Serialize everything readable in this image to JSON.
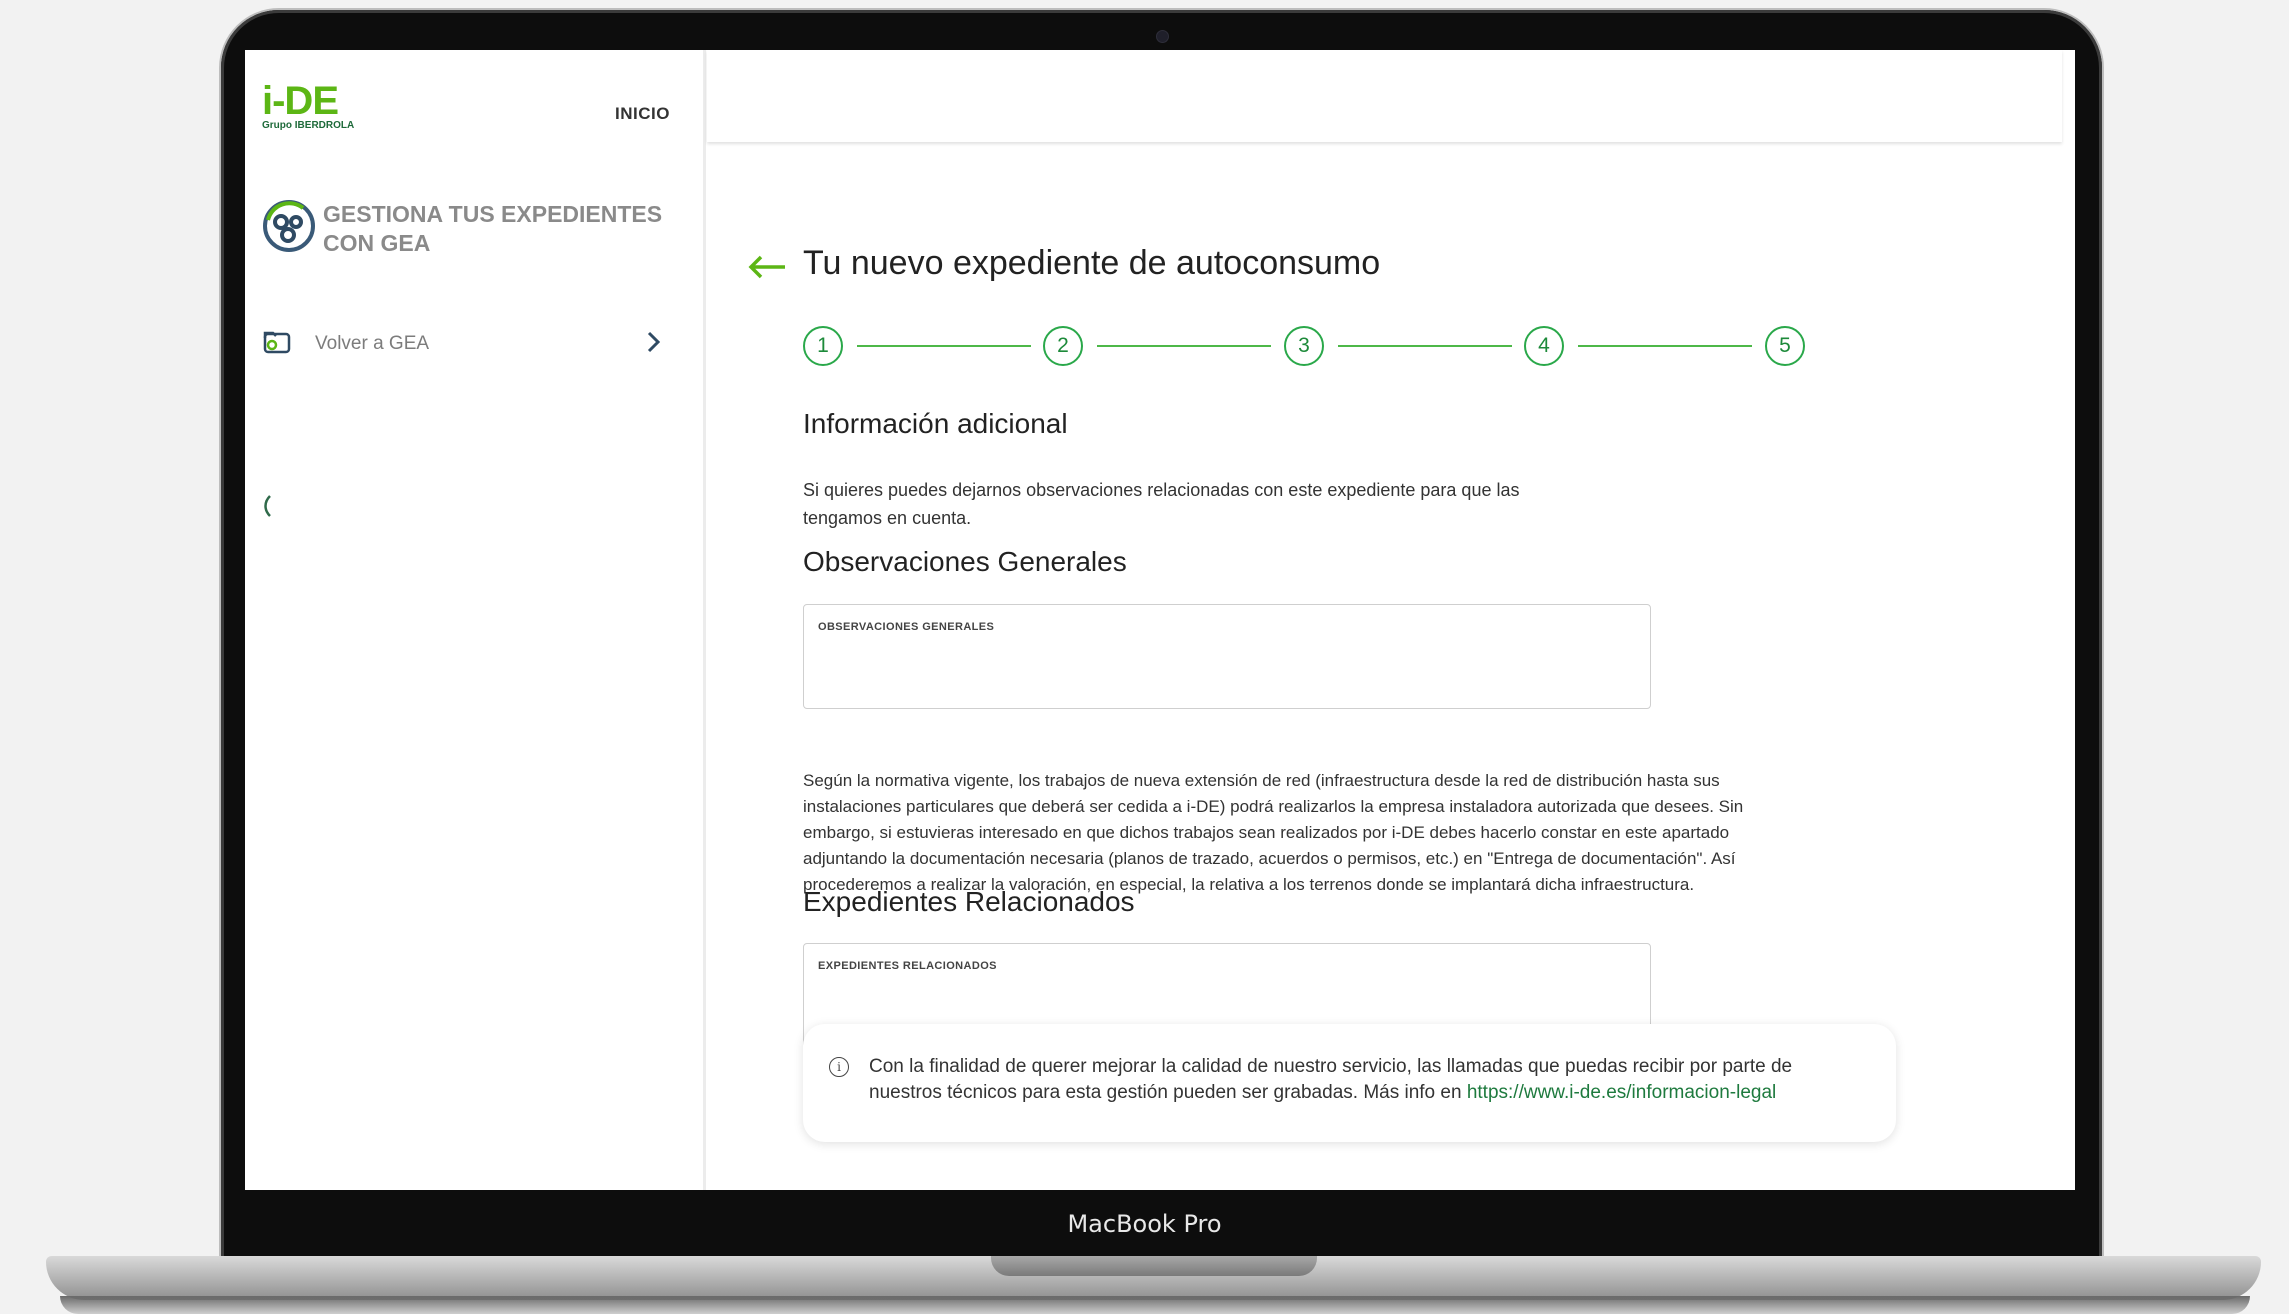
{
  "device": {
    "model_label": "MacBook Pro"
  },
  "sidebar": {
    "logo": {
      "main": "i-DE",
      "sub": "Grupo IBERDROLA"
    },
    "nav_inicio": "INICIO",
    "gea_title": "GESTIONA TUS EXPEDIENTES CON GEA",
    "volver_label": "Volver a GEA"
  },
  "main": {
    "title": "Tu nuevo expediente de autoconsumo",
    "steps": [
      "1",
      "2",
      "3",
      "4",
      "5"
    ],
    "section_info": {
      "heading": "Información adicional",
      "text_line1": "Si quieres puedes dejarnos observaciones relacionadas con este expediente para que las",
      "text_line2": "tengamos en cuenta."
    },
    "observaciones": {
      "heading": "Observaciones Generales",
      "field_label": "OBSERVACIONES GENERALES",
      "value": ""
    },
    "normativa": {
      "line1": "Según la normativa vigente, los trabajos de nueva extensión de red (infraestructura desde la red de distribución hasta sus",
      "line2": "instalaciones particulares que deberá ser cedida a i-DE) podrá realizarlos la empresa instaladora autorizada que desees. Sin",
      "line3": "embargo, si estuvieras interesado en que dichos trabajos sean realizados por i-DE debes hacerlo constar en este apartado",
      "line4": "adjuntando la documentación necesaria (planos de trazado, acuerdos o permisos, etc.) en \"Entrega de documentación\". Así",
      "line5": "procederemos a realizar la valoración, en especial, la relativa a los terrenos donde se implantará dicha infraestructura."
    },
    "relacionados": {
      "heading": "Expedientes Relacionados",
      "field_label": "EXPEDIENTES RELACIONADOS",
      "value": ""
    },
    "info_notice": {
      "line1": "Con la finalidad de querer mejorar la calidad de nuestro servicio, las llamadas que puedas recibir por parte de",
      "line2_prefix": "nuestros técnicos para esta gestión pueden ser grabadas. Más info en ",
      "link": "https://www.i-de.es/informacion-legal"
    }
  },
  "colors": {
    "brand_green": "#5cb615",
    "dark_green": "#0d7a3e",
    "step_green": "#2aa84a"
  }
}
